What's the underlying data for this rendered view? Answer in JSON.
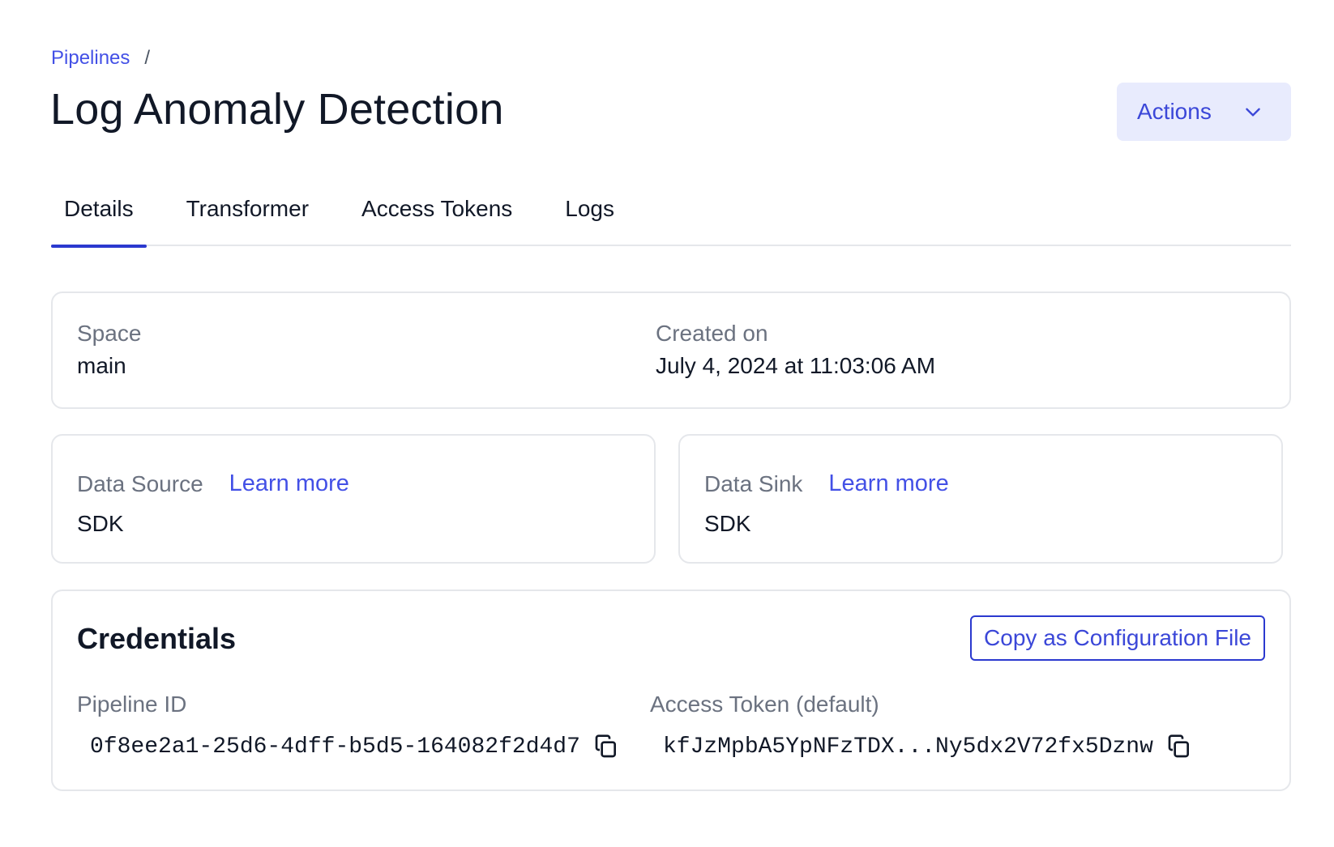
{
  "breadcrumb": {
    "parent": "Pipelines",
    "separator": "/"
  },
  "title": "Log Anomaly Detection",
  "actions": {
    "label": "Actions",
    "icon": "chevron-down-icon"
  },
  "tabs": [
    {
      "label": "Details",
      "active": true
    },
    {
      "label": "Transformer",
      "active": false
    },
    {
      "label": "Access Tokens",
      "active": false
    },
    {
      "label": "Logs",
      "active": false
    }
  ],
  "overview": {
    "space_label": "Space",
    "space_value": "main",
    "created_label": "Created on",
    "created_value": "July 4, 2024 at 11:03:06 AM"
  },
  "data_source": {
    "label": "Data Source",
    "link": "Learn more",
    "value": "SDK"
  },
  "data_sink": {
    "label": "Data Sink",
    "link": "Learn more",
    "value": "SDK"
  },
  "credentials": {
    "title": "Credentials",
    "copy_config_label": "Copy as Configuration File",
    "pipeline_id_label": "Pipeline ID",
    "pipeline_id_value": "0f8ee2a1-25d6-4dff-b5d5-164082f2d4d7",
    "access_token_label": "Access Token (default)",
    "access_token_value": "kfJzMpbA5YpNFzTDX...Ny5dx2V72fx5Dznw"
  },
  "colors": {
    "accent": "#2b39cf",
    "link": "#4350e6",
    "actions_bg": "#e8ebfd",
    "border": "#e5e7eb",
    "muted_text": "#6b7280"
  }
}
